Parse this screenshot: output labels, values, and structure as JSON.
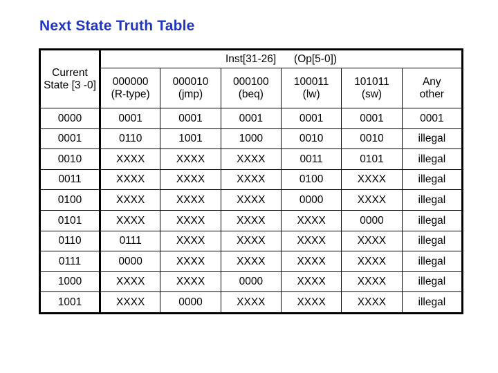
{
  "slide": {
    "title": "Next State Truth Table",
    "title_color": "#2035C0",
    "background": "#ffffff"
  },
  "table": {
    "state_header": "Current State [3 -0]",
    "group_header": "Inst[31-26]      (Op[5-0])",
    "columns": [
      {
        "code": "000000",
        "mnemonic": "(R-type)"
      },
      {
        "code": "000010",
        "mnemonic": "(jmp)"
      },
      {
        "code": "000100",
        "mnemonic": "(beq)"
      },
      {
        "code": "100011",
        "mnemonic": "(lw)"
      },
      {
        "code": "101011",
        "mnemonic": "(sw)"
      },
      {
        "code": "Any",
        "mnemonic": "other"
      }
    ],
    "rows": [
      {
        "state": "0000",
        "values": [
          "0001",
          "0001",
          "0001",
          "0001",
          "0001",
          "0001"
        ]
      },
      {
        "state": "0001",
        "values": [
          "0110",
          "1001",
          "1000",
          "0010",
          "0010",
          "illegal"
        ]
      },
      {
        "state": "0010",
        "values": [
          "XXXX",
          "XXXX",
          "XXXX",
          "0011",
          "0101",
          "illegal"
        ]
      },
      {
        "state": "0011",
        "values": [
          "XXXX",
          "XXXX",
          "XXXX",
          "0100",
          "XXXX",
          "illegal"
        ]
      },
      {
        "state": "0100",
        "values": [
          "XXXX",
          "XXXX",
          "XXXX",
          "0000",
          "XXXX",
          "illegal"
        ]
      },
      {
        "state": "0101",
        "values": [
          "XXXX",
          "XXXX",
          "XXXX",
          "XXXX",
          "0000",
          "illegal"
        ]
      },
      {
        "state": "0110",
        "values": [
          "0111",
          "XXXX",
          "XXXX",
          "XXXX",
          "XXXX",
          "illegal"
        ]
      },
      {
        "state": "0111",
        "values": [
          "0000",
          "XXXX",
          "XXXX",
          "XXXX",
          "XXXX",
          "illegal"
        ]
      },
      {
        "state": "1000",
        "values": [
          "XXXX",
          "XXXX",
          "0000",
          "XXXX",
          "XXXX",
          "illegal"
        ]
      },
      {
        "state": "1001",
        "values": [
          "XXXX",
          "0000",
          "XXXX",
          "XXXX",
          "XXXX",
          "illegal"
        ]
      }
    ]
  }
}
